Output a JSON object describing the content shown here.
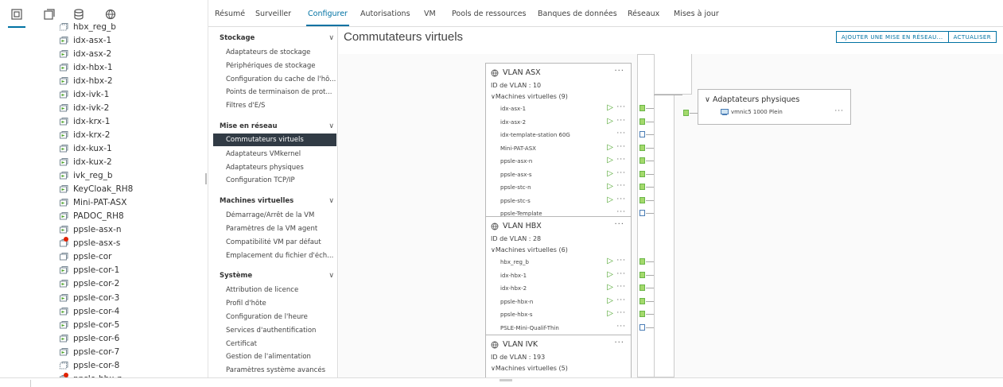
{
  "left_panel": {
    "tabs": [
      {
        "icon": "hosts-clusters-icon"
      },
      {
        "icon": "vms-templates-icon"
      },
      {
        "icon": "storage-icon"
      },
      {
        "icon": "networking-icon"
      }
    ],
    "tree_items": [
      {
        "label": "hbx_reg_b",
        "state": "template"
      },
      {
        "label": "idx-asx-1",
        "state": "on"
      },
      {
        "label": "idx-asx-2",
        "state": "on"
      },
      {
        "label": "idx-hbx-1",
        "state": "on"
      },
      {
        "label": "idx-hbx-2",
        "state": "on"
      },
      {
        "label": "idx-ivk-1",
        "state": "on"
      },
      {
        "label": "idx-ivk-2",
        "state": "on"
      },
      {
        "label": "idx-krx-1",
        "state": "on"
      },
      {
        "label": "idx-krx-2",
        "state": "on"
      },
      {
        "label": "idx-kux-1",
        "state": "on"
      },
      {
        "label": "idx-kux-2",
        "state": "on"
      },
      {
        "label": "ivk_reg_b",
        "state": "on"
      },
      {
        "label": "KeyCloak_RH8",
        "state": "on"
      },
      {
        "label": "Mini-PAT-ASX",
        "state": "on"
      },
      {
        "label": "PADOC_RH8",
        "state": "on"
      },
      {
        "label": "ppsle-asx-n",
        "state": "on"
      },
      {
        "label": "ppsle-asx-s",
        "state": "alert"
      },
      {
        "label": "ppsle-cor",
        "state": "off"
      },
      {
        "label": "ppsle-cor-1",
        "state": "on"
      },
      {
        "label": "ppsle-cor-2",
        "state": "on"
      },
      {
        "label": "ppsle-cor-3",
        "state": "on"
      },
      {
        "label": "ppsle-cor-4",
        "state": "on"
      },
      {
        "label": "ppsle-cor-5",
        "state": "on"
      },
      {
        "label": "ppsle-cor-6",
        "state": "on"
      },
      {
        "label": "ppsle-cor-7",
        "state": "on"
      },
      {
        "label": "ppsle-cor-8",
        "state": "template"
      },
      {
        "label": "ppsle-hbx-n",
        "state": "alert"
      }
    ]
  },
  "tabs": [
    {
      "label": "Résumé",
      "active": false
    },
    {
      "label": "Surveiller",
      "active": false
    },
    {
      "label": "Configurer",
      "active": true
    },
    {
      "label": "Autorisations",
      "active": false
    },
    {
      "label": "VM",
      "active": false
    },
    {
      "label": "Pools de ressources",
      "active": false
    },
    {
      "label": "Banques de données",
      "active": false
    },
    {
      "label": "Réseaux",
      "active": false
    },
    {
      "label": "Mises à jour",
      "active": false
    }
  ],
  "nav": {
    "sections": [
      {
        "label": "Stockage",
        "items": [
          "Adaptateurs de stockage",
          "Périphériques de stockage",
          "Configuration du cache de l'hô...",
          "Points de terminaison de prot...",
          "Filtres d'E/S"
        ]
      },
      {
        "label": "Mise en réseau",
        "items": [
          "Commutateurs virtuels",
          "Adaptateurs VMkernel",
          "Adaptateurs physiques",
          "Configuration TCP/IP"
        ]
      },
      {
        "label": "Machines virtuelles",
        "items": [
          "Démarrage/Arrêt de la VM",
          "Paramètres de la VM agent",
          "Compatibilité VM par défaut",
          "Emplacement du fichier d'éch..."
        ]
      },
      {
        "label": "Système",
        "items": [
          "Attribution de licence",
          "Profil d'hôte",
          "Configuration de l'heure",
          "Services d'authentification",
          "Certificat",
          "Gestion de l'alimentation",
          "Paramètres système avancés"
        ]
      }
    ],
    "selected": "Commutateurs virtuels",
    "chevron": "∨"
  },
  "main": {
    "title": "Commutateurs virtuels",
    "buttons": {
      "add_network": "AJOUTER UNE MISE EN RÉSEAU...",
      "refresh": "ACTUALISER"
    }
  },
  "port_groups": [
    {
      "name": "VLAN ASX",
      "vlan": "ID de VLAN : 10",
      "vm_header": "Machines virtuelles (9)",
      "vms": [
        {
          "name": "idx-asx-1",
          "powered": true
        },
        {
          "name": "idx-asx-2",
          "powered": true
        },
        {
          "name": "idx-template-station 60G",
          "powered": false
        },
        {
          "name": "Mini-PAT-ASX",
          "powered": true
        },
        {
          "name": "ppsle-asx-n",
          "powered": true
        },
        {
          "name": "ppsle-asx-s",
          "powered": true
        },
        {
          "name": "ppsle-stc-n",
          "powered": true
        },
        {
          "name": "ppsle-stc-s",
          "powered": true
        },
        {
          "name": "ppsle-Template",
          "powered": false
        }
      ]
    },
    {
      "name": "VLAN HBX",
      "vlan": "ID de VLAN : 28",
      "vm_header": "Machines virtuelles (6)",
      "vms": [
        {
          "name": "hbx_reg_b",
          "powered": true
        },
        {
          "name": "idx-hbx-1",
          "powered": true
        },
        {
          "name": "idx-hbx-2",
          "powered": true
        },
        {
          "name": "ppsle-hbx-n",
          "powered": true
        },
        {
          "name": "ppsle-hbx-s",
          "powered": true
        },
        {
          "name": "PSLE-Mini-Qualif-Thin",
          "powered": false
        }
      ]
    },
    {
      "name": "VLAN IVK",
      "vlan": "ID de VLAN : 193",
      "vm_header": "Machines virtuelles (5)",
      "vms": []
    }
  ],
  "physical_adapters": {
    "title": "Adaptateurs physiques",
    "items": [
      {
        "label": "vmnic5 1000 Plein"
      }
    ]
  },
  "glyphs": {
    "more": "···",
    "play": "▷",
    "expand": "∨"
  },
  "colors": {
    "accent": "#0072a3",
    "selected_nav_bg": "#313b45",
    "port_on": "#a4d96c",
    "play": "#4aa329",
    "alert": "#e12200"
  }
}
